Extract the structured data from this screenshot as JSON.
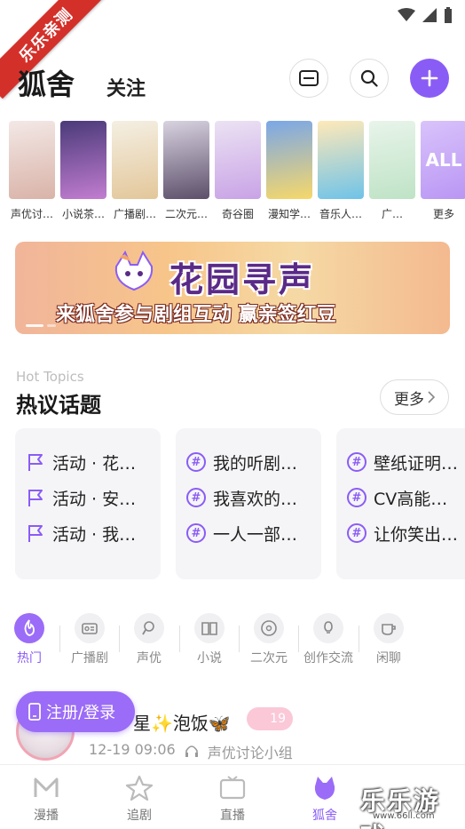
{
  "corner_badge": "乐乐亲测",
  "header": {
    "title": "狐舍",
    "follow_tab": "关注"
  },
  "categories": [
    {
      "label": "声优讨…",
      "colors": [
        "#f3e8e6",
        "#d9b3a8"
      ]
    },
    {
      "label": "小说茶…",
      "colors": [
        "#4a3a7a",
        "#c27dd0"
      ]
    },
    {
      "label": "广播剧…",
      "colors": [
        "#f4efe3",
        "#e3c79a"
      ]
    },
    {
      "label": "二次元…",
      "colors": [
        "#d8d2e0",
        "#5c4f6a"
      ]
    },
    {
      "label": "奇谷圈",
      "colors": [
        "#ebe2f3",
        "#c9a3e6"
      ]
    },
    {
      "label": "漫知学…",
      "colors": [
        "#7aa7e8",
        "#f6d86a"
      ]
    },
    {
      "label": "音乐人…",
      "colors": [
        "#ffe9b8",
        "#6fc3e8"
      ]
    },
    {
      "label": "广…",
      "colors": [
        "#e8f4ea",
        "#bfe3c6"
      ]
    },
    {
      "label": "更多",
      "more": true,
      "thumb_text": "ALL"
    }
  ],
  "banner": {
    "title": "花园寻声",
    "subtitle": "来狐舍参与剧组互动 赢亲签红豆"
  },
  "hot_topics": {
    "en_label": "Hot Topics",
    "title": "热议话题",
    "more_label": "更多",
    "cards": [
      {
        "items": [
          {
            "text": "活动 · 花…",
            "icon": "flag-icon"
          },
          {
            "text": "活动 · 安…",
            "icon": "flag-icon"
          },
          {
            "text": "活动 · 我…",
            "icon": "flag-icon"
          }
        ]
      },
      {
        "items": [
          {
            "text": "我的听剧…",
            "icon": "hashtag-icon"
          },
          {
            "text": "我喜欢的…",
            "icon": "hashtag-icon"
          },
          {
            "text": "一人一部…",
            "icon": "hashtag-icon"
          }
        ]
      },
      {
        "items": [
          {
            "text": "壁纸证明…",
            "icon": "hashtag-icon"
          },
          {
            "text": "CV高能…",
            "icon": "hashtag-icon"
          },
          {
            "text": "让你笑出…",
            "icon": "hashtag-icon"
          }
        ]
      }
    ]
  },
  "subtabs": [
    {
      "label": "热门",
      "icon": "flame-icon",
      "active": true
    },
    {
      "label": "广播剧",
      "icon": "radio-icon"
    },
    {
      "label": "声优",
      "icon": "microphone-icon"
    },
    {
      "label": "小说",
      "icon": "book-icon"
    },
    {
      "label": "二次元",
      "icon": "disc-icon"
    },
    {
      "label": "创作交流",
      "icon": "lightbulb-icon"
    },
    {
      "label": "闲聊",
      "icon": "cup-icon"
    }
  ],
  "post": {
    "login_label": "注册/登录",
    "name": "星✨泡饭🦋",
    "level": "19",
    "time": "12-19 09:06",
    "group": "声优讨论小组"
  },
  "bottom_nav": [
    {
      "label": "漫播",
      "icon": "manbo-icon"
    },
    {
      "label": "追剧",
      "icon": "star-icon"
    },
    {
      "label": "直播",
      "icon": "live-icon"
    },
    {
      "label": "狐舍",
      "icon": "fox-icon",
      "active": true
    }
  ],
  "watermark": {
    "text": "乐乐游戏",
    "url": "www.66ll.com"
  },
  "colors": {
    "accent": "#8a5cf6",
    "card_bg": "#f5f5f7"
  }
}
